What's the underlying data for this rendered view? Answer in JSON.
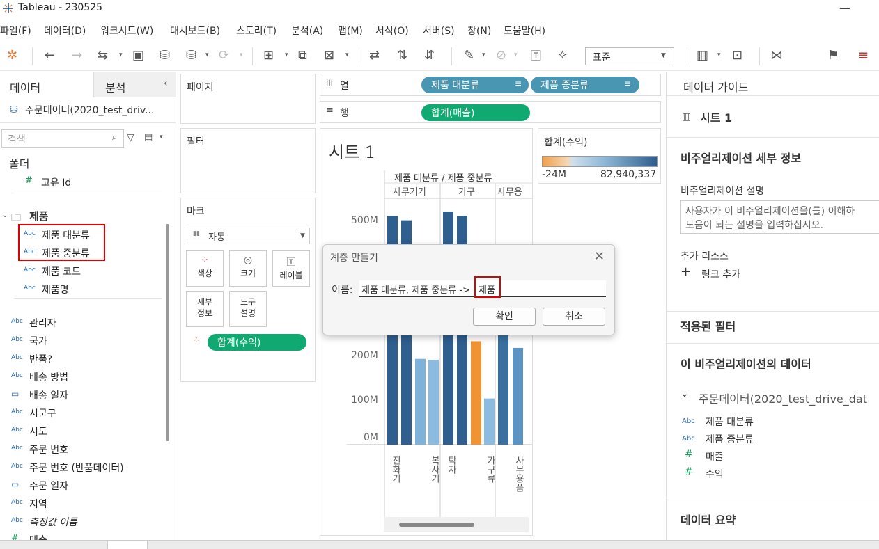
{
  "window": {
    "title": "Tableau - 230525"
  },
  "menu": [
    "파일(F)",
    "데이터(D)",
    "워크시트(W)",
    "대시보드(B)",
    "스토리(T)",
    "분석(A)",
    "맵(M)",
    "서식(O)",
    "서버(S)",
    "창(N)",
    "도움말(H)"
  ],
  "toolbar": {
    "view_size": "표준"
  },
  "data_pane": {
    "tab_data": "데이터",
    "tab_analysis": "분석",
    "datasource": "주문데이터(2020_test_driv...",
    "search_placeholder": "검색",
    "folders_label": "폴더",
    "unique_id": "고유 Id",
    "group_product": "제품",
    "hierarchy_fields": [
      "제품 대분류",
      "제품 중분류"
    ],
    "product_fields": [
      "제품 코드",
      "제품명"
    ],
    "other_fields": [
      "관리자",
      "국가",
      "반품?",
      "배송 방법",
      "배송 일자",
      "시군구",
      "시도",
      "주문 번호",
      "주문 번호 (반품데이터)",
      "주문 일자",
      "지역",
      "측정값 이름",
      "매출"
    ]
  },
  "shelves": {
    "pages": "페이지",
    "filters": "필터",
    "marks": "마크",
    "mark_type": "자동",
    "mark_buttons": [
      "색상",
      "크기",
      "레이블",
      "세부\n정보",
      "도구\n설명"
    ],
    "color_pill": "합계(수익)",
    "columns_label": "열",
    "rows_label": "행",
    "columns_pills": [
      "제품 대분류",
      "제품 중분류"
    ],
    "rows_pills": [
      "합계(매출)"
    ]
  },
  "sheet": {
    "title": "시트 1",
    "header": "제품 대분류 / 제품 중분류",
    "categories": [
      "사무기기",
      "가구",
      "사무용"
    ],
    "y_ticks": [
      "500M",
      "200M",
      "100M",
      "0M"
    ],
    "sub_labels": [
      "전화기",
      "복사기",
      "탁자",
      "가구류",
      "사무용품"
    ]
  },
  "chart_data": {
    "type": "bar",
    "categories": [
      "사무기기",
      "사무기기",
      "사무기기",
      "사무기기",
      "가구",
      "가구",
      "가구",
      "가구",
      "사무용",
      "사무용"
    ],
    "values": [
      520,
      510,
      195,
      193,
      530,
      520,
      235,
      105,
      440,
      220
    ],
    "colors": [
      "#2e5f8e",
      "#2e5f8e",
      "#7fb2d8",
      "#8bbcdf",
      "#2e5f8e",
      "#2e5f8e",
      "#ef9334",
      "#8bbcdf",
      "#3a6f9f",
      "#5b93c2"
    ],
    "ylabel": "",
    "ylim": [
      0,
      560
    ]
  },
  "legend": {
    "title": "합계(수익)",
    "min": "-24M",
    "max": "82,940,337"
  },
  "dialog": {
    "title": "계층 만들기",
    "name_label": "이름:",
    "name_prefix": "제품 대분류, 제품 중분류 ->",
    "name_highlight": "제품",
    "ok": "확인",
    "cancel": "취소"
  },
  "guide": {
    "header": "데이터 가이드",
    "sheet": "시트 1",
    "detail_title": "비주얼리제이션 세부 정보",
    "desc_label": "비주얼리제이션 설명",
    "desc_placeholder_1": "사용자가 이 비주얼리제이션을(를) 이해하",
    "desc_placeholder_2": "도움이 되는 설명을 입력하십시오.",
    "resources": "추가 리소스",
    "add_link": "링크 추가",
    "applied_filters": "적용된 필터",
    "viz_data": "이 비주얼리제이션의 데이터",
    "datasource": "주문데이터(2020_test_drive_dat",
    "fields": [
      "제품 대분류",
      "제품 중분류",
      "매출",
      "수익"
    ],
    "summary": "데이터 요약"
  },
  "colors": {
    "blue_pill": "#4996b2",
    "green_pill": "#10a971",
    "highlight": "#e00000"
  }
}
